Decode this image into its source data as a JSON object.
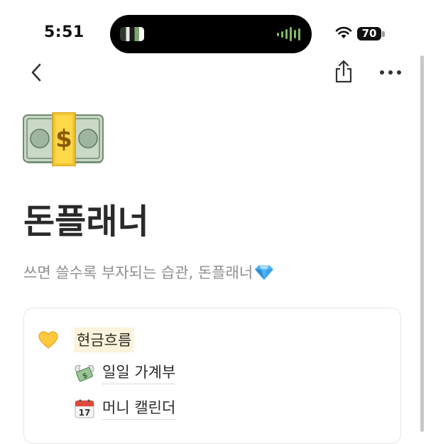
{
  "status_bar": {
    "time": "5:51",
    "battery": "70",
    "icons": [
      "now-playing-thumbnail",
      "audio-waveform-icon",
      "wifi-icon",
      "battery-icon"
    ]
  },
  "nav": {
    "icons": [
      "chevron-left-icon",
      "share-icon",
      "more-icon"
    ]
  },
  "page": {
    "icon": "banknote-with-dollar-sign-emoji",
    "title": "돈플래너",
    "subtitle": "쓰면 쓸수록 부자되는 습관, 돈플래너",
    "subtitle_icon": "gem-emoji"
  },
  "card": {
    "section": {
      "icon": "yellow-heart-emoji",
      "label": "현금흐름",
      "highlight_color": "#fbf3db"
    },
    "items": [
      {
        "icon": "money-with-wings-emoji",
        "label": "일일 가계부"
      },
      {
        "icon": "calendar-17-emoji",
        "label": "머니 캘린더"
      }
    ]
  },
  "colors": {
    "title": "#2a2a2a",
    "subtitle": "#8f8f8f",
    "card_border": "#e4e4e4"
  }
}
